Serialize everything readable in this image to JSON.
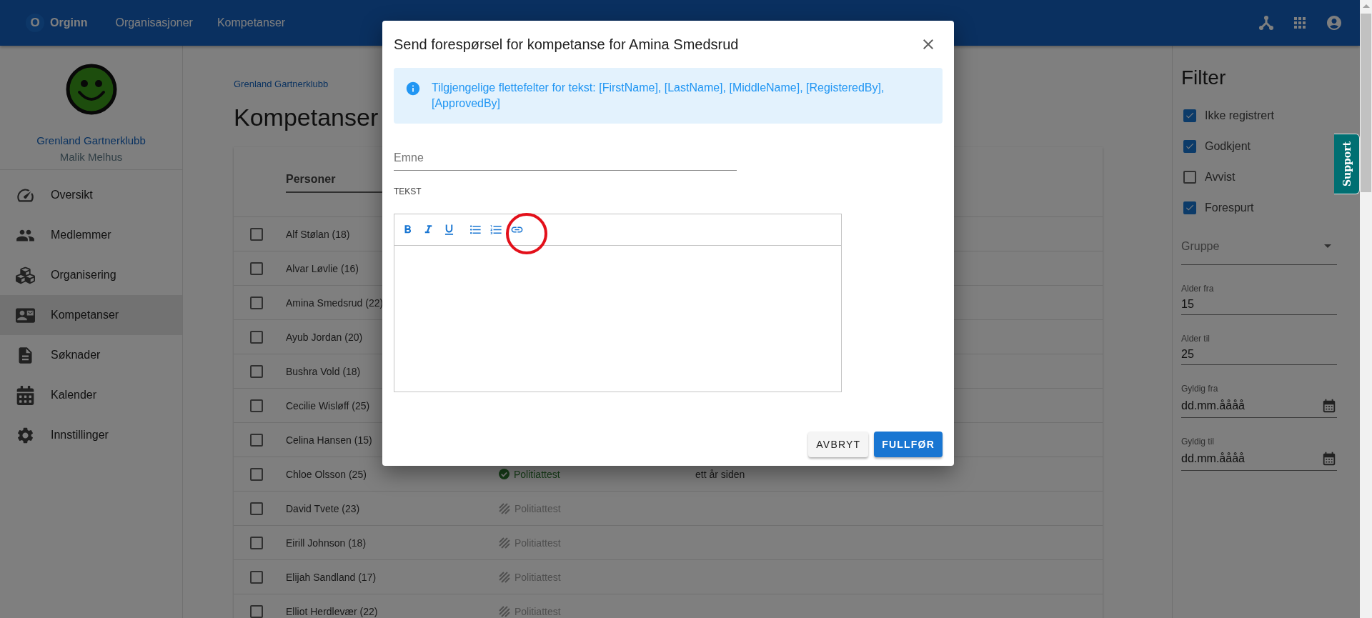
{
  "app_bar": {
    "logo_letter": "O",
    "brand": "Orginn",
    "nav": [
      {
        "label": "Organisasjoner"
      },
      {
        "label": "Kompetanser"
      }
    ]
  },
  "sidebar": {
    "organization": "Grenland Gartnerklubb",
    "user": "Malik Melhus",
    "items": [
      {
        "label": "Oversikt",
        "selected": false
      },
      {
        "label": "Medlemmer",
        "selected": false
      },
      {
        "label": "Organisering",
        "selected": false
      },
      {
        "label": "Kompetanser",
        "selected": true
      },
      {
        "label": "Søknader",
        "selected": false
      },
      {
        "label": "Kalender",
        "selected": false
      },
      {
        "label": "Innstillinger",
        "selected": false
      }
    ]
  },
  "breadcrumb": "Grenland Gartnerklubb",
  "title": "Kompetanser",
  "table": {
    "columns": [
      "Personer"
    ],
    "rows": [
      {
        "name": "Alf Stølan (18)",
        "checked": false
      },
      {
        "name": "Alvar Løvlie (16)",
        "checked": false
      },
      {
        "name": "Amina Smedsrud (22)",
        "checked": false
      },
      {
        "name": "Ayub Jordan (20)",
        "checked": false
      },
      {
        "name": "Bushra Vold (18)",
        "checked": false
      },
      {
        "name": "Cecilie Wisløff (25)",
        "checked": false
      },
      {
        "name": "Celina Hansen (15)",
        "checked": false
      },
      {
        "name": "Chloe Olsson (25)",
        "checked": false,
        "status": {
          "label": "Politiattest",
          "kind": "approved"
        },
        "column_3": "ett år siden"
      },
      {
        "name": "David Tvete (23)",
        "checked": false,
        "status": {
          "label": "Politiattest",
          "kind": "missing"
        }
      },
      {
        "name": "Eirill Johnson (18)",
        "checked": false,
        "status": {
          "label": "Politiattest",
          "kind": "missing"
        }
      },
      {
        "name": "Elijah Sandland (17)",
        "checked": false,
        "status": {
          "label": "Politiattest",
          "kind": "missing"
        }
      },
      {
        "name": "Elliot Herdlevær (22)",
        "checked": false,
        "status": {
          "label": "Politiattest",
          "kind": "missing"
        }
      }
    ]
  },
  "filter": {
    "title": "Filter",
    "checks": [
      {
        "label": "Ikke registrert",
        "checked": true
      },
      {
        "label": "Godkjent",
        "checked": true
      },
      {
        "label": "Avvist",
        "checked": false
      },
      {
        "label": "Forespurt",
        "checked": true
      }
    ],
    "group": {
      "placeholder": "Gruppe"
    },
    "fields": [
      {
        "label": "Alder fra",
        "value": "15",
        "kind": "text"
      },
      {
        "label": "Alder til",
        "value": "25",
        "kind": "text"
      },
      {
        "label": "Gyldig fra",
        "value": "dd.mm.åååå",
        "kind": "date"
      },
      {
        "label": "Gyldig til",
        "value": "dd.mm.åååå",
        "kind": "date"
      }
    ]
  },
  "support_tab": "Support",
  "dialog": {
    "title": "Send forespørsel for kompetanse for Amina Smedsrud",
    "info": "Tilgjengelige flettefelter for tekst: [FirstName], [LastName], [MiddleName], [RegisteredBy], [ApprovedBy]",
    "subject": {
      "placeholder": "Emne"
    },
    "text_label": "TEKST",
    "buttons": [
      {
        "label": "AVBRYT",
        "kind": "secondary"
      },
      {
        "label": "FULLFØR",
        "kind": "primary"
      }
    ]
  }
}
